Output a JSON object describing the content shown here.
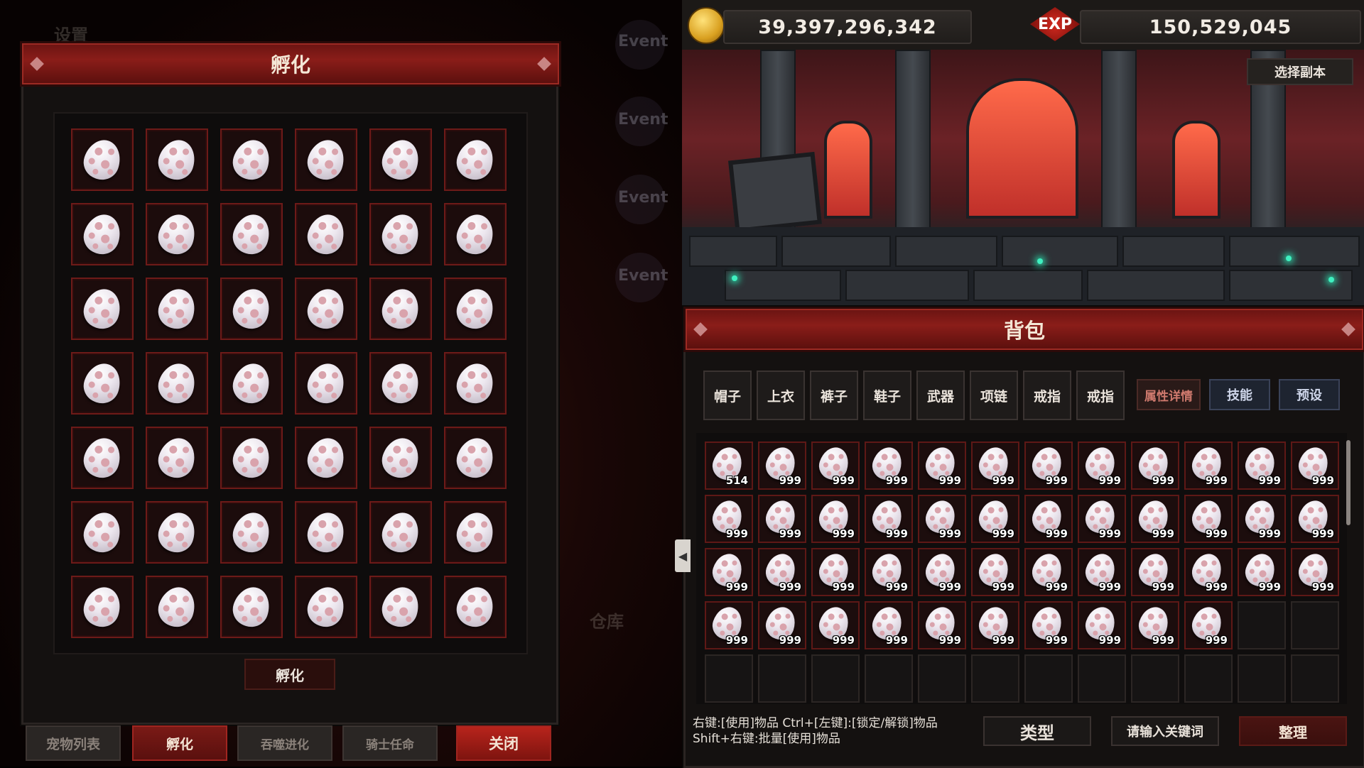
{
  "hatch_window": {
    "ghost_settings": "设置",
    "title": "孵化",
    "hatch_button": "孵化",
    "bottom_tabs": [
      {
        "label": "宠物列表",
        "state": "inactive"
      },
      {
        "label": "孵化",
        "state": "active"
      },
      {
        "label": "吞噬进化",
        "state": "inactive"
      },
      {
        "label": "骑士任命",
        "state": "inactive"
      }
    ],
    "close_button": "关闭"
  },
  "background": {
    "events": [
      "Event",
      "Event",
      "Event",
      "Event"
    ],
    "warehouse": "仓库"
  },
  "currency": {
    "gold_icon": "gold-coin-icon",
    "gold": "39,397,296,342",
    "exp_icon_label": "EXP",
    "exp": "150,529,045"
  },
  "stage": {
    "select_dungeon_button": "选择副本"
  },
  "bag": {
    "title": "背包",
    "equip_tabs": [
      "帽子",
      "上衣",
      "裤子",
      "鞋子",
      "武器",
      "项链",
      "戒指",
      "戒指"
    ],
    "attr_details_button": "属性详情",
    "skills_button": "技能",
    "preset_button": "预设",
    "quantities": [
      "514",
      "999",
      "999",
      "999",
      "999",
      "999",
      "999",
      "999",
      "999",
      "999",
      "999",
      "999",
      "999",
      "999",
      "999",
      "999",
      "999",
      "999",
      "999",
      "999",
      "999",
      "999",
      "999",
      "999",
      "999",
      "999",
      "999",
      "999",
      "999",
      "999",
      "999",
      "999",
      "999",
      "999",
      "999",
      "999",
      "999",
      "999",
      "999",
      "999",
      "999",
      "999",
      "999",
      "999",
      "999",
      "999"
    ],
    "hint_line1": "右键:[使用]物品 Ctrl+[左键]:[锁定/解锁]物品",
    "hint_line2": "Shift+右键:批量[使用]物品",
    "type_button": "类型",
    "search_placeholder": "请输入关键词",
    "sort_button": "整理"
  },
  "colors": {
    "accent_red": "#8a1d19",
    "cell_border": "#6d1a18",
    "egg_spot": "#d9a3ac"
  }
}
